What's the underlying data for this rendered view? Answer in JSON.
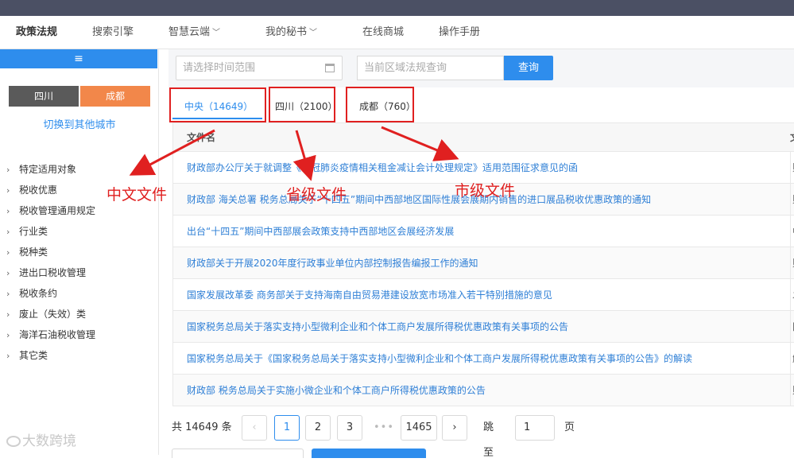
{
  "nav": {
    "items": [
      {
        "label": "政策法规",
        "active": true
      },
      {
        "label": "搜索引擎"
      },
      {
        "label": "智慧云端",
        "dropdown": true
      },
      {
        "label": "我的秘书",
        "dropdown": true
      },
      {
        "label": "在线商城"
      },
      {
        "label": "操作手册"
      }
    ]
  },
  "sidebar": {
    "menu_icon": "≡",
    "city_primary": "四川",
    "city_secondary": "成都",
    "switch_label": "切换到其他城市",
    "categories": [
      "特定适用对象",
      "税收优惠",
      "税收管理通用规定",
      "行业类",
      "税种类",
      "进出口税收管理",
      "税收条约",
      "废止（失效）类",
      "海洋石油税收管理",
      "其它类"
    ]
  },
  "filter": {
    "date_placeholder": "请选择时间范围",
    "search_placeholder": "当前区域法规查询",
    "query_label": "查询"
  },
  "tabs": [
    {
      "label": "中央（14649）",
      "active": true
    },
    {
      "label": "四川（2100）"
    },
    {
      "label": "成都（760）"
    }
  ],
  "table": {
    "header_name": "文件名",
    "header_second": "文",
    "rows": [
      {
        "name": "财政部办公厅关于就调整《新冠肺炎疫情相关租金减让会计处理规定》适用范围征求意见的函",
        "type": "财"
      },
      {
        "name": "财政部 海关总署 税务总局关于“十四五”期间中西部地区国际性展会展期内销售的进口展品税收优惠政策的通知",
        "type": "财"
      },
      {
        "name": "出台“十四五”期间中西部展会政策支持中西部地区会展经济发展",
        "type": "中"
      },
      {
        "name": "财政部关于开展2020年度行政事业单位内部控制报告编报工作的通知",
        "type": "财"
      },
      {
        "name": "国家发展改革委 商务部关于支持海南自由贸易港建设放宽市场准入若干特别措施的意见",
        "type": "发"
      },
      {
        "name": "国家税务总局关于落实支持小型微利企业和个体工商户发展所得税优惠政策有关事项的公告",
        "type": "国"
      },
      {
        "name": "国家税务总局关于《国家税务总局关于落实支持小型微利企业和个体工商户发展所得税优惠政策有关事项的公告》的解读",
        "type": "解"
      },
      {
        "name": "财政部 税务总局关于实施小微企业和个体工商户所得税优惠政策的公告",
        "type": "财"
      }
    ]
  },
  "pager": {
    "total": "共 14649 条",
    "prev": "‹",
    "pages": [
      "1",
      "2",
      "3"
    ],
    "dots": "•••",
    "last": "1465",
    "next": "›",
    "jump_label": "跳至",
    "jump_value": "1",
    "page_unit": "页"
  },
  "annotations": {
    "central": "中文文件",
    "provincial": "省级文件",
    "city": "市级文件",
    "color": "#e02020"
  },
  "watermark": "大数跨境",
  "colors": {
    "accent": "#2e8ded",
    "orange": "#f2874a",
    "topbar": "#4b5064"
  }
}
